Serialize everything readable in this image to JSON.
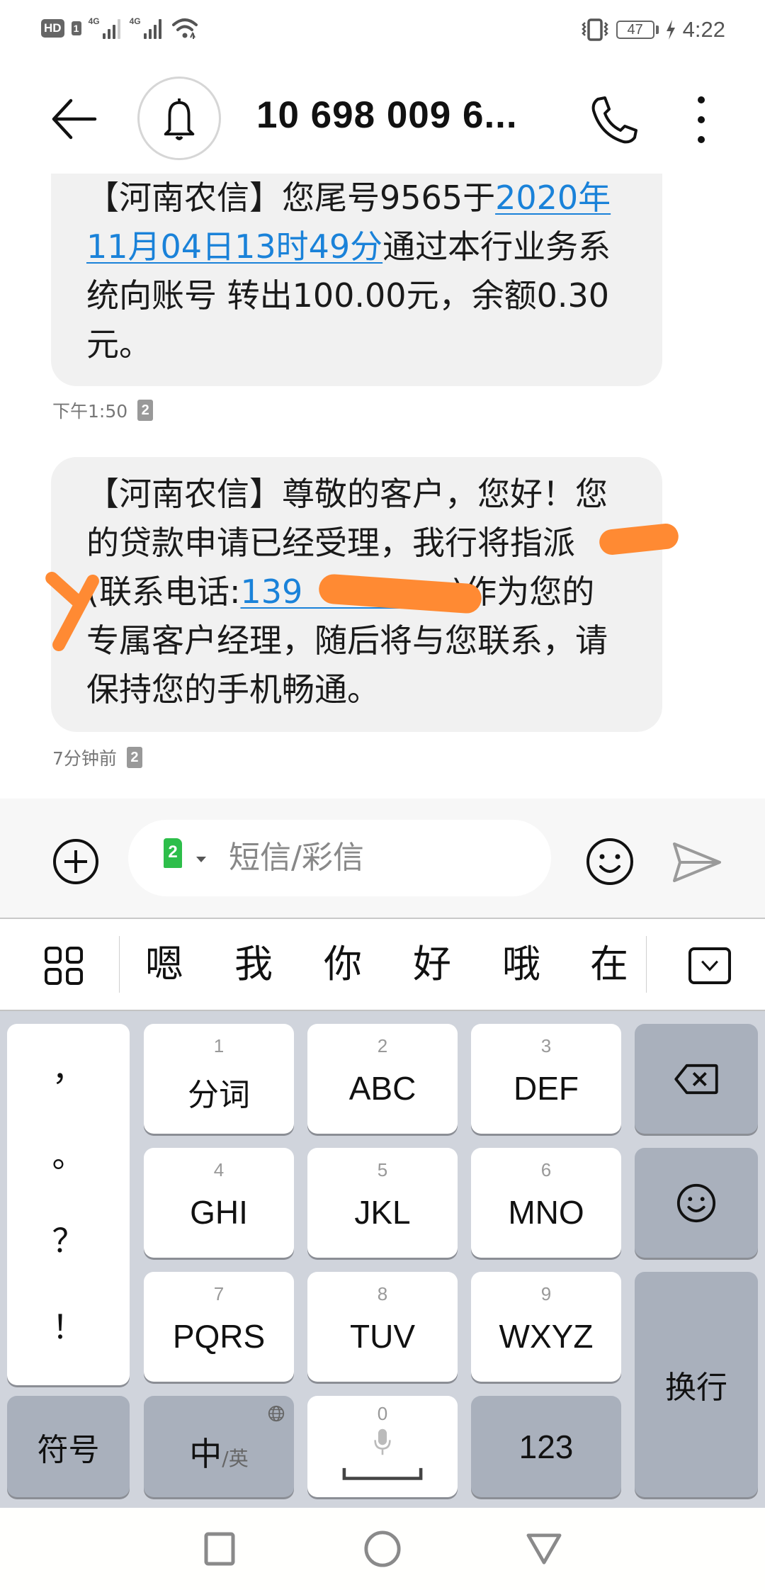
{
  "status_bar": {
    "hd_label": "HD",
    "sim_label": "1",
    "network_1": "4G",
    "network_2": "4G",
    "battery_level": "47",
    "time": "4:22",
    "icons": [
      "hd-voice-icon",
      "signal-icon",
      "signal-icon",
      "wifi-icon",
      "vibrate-icon",
      "battery-icon",
      "charging-icon"
    ]
  },
  "header": {
    "title": "10 698 009 6...",
    "icons": [
      "back-arrow-icon",
      "bell-icon",
      "phone-icon",
      "more-vertical-icon"
    ]
  },
  "messages": [
    {
      "segments": [
        {
          "text": "【河南农信】您尾号9565于",
          "link": false
        },
        {
          "text": "2020年11月04日13时49分",
          "link": true
        },
        {
          "text": "通过本行业务系统向账号 转出100.00元，余额0.30元。",
          "link": false
        }
      ],
      "timestamp": "下午1:50",
      "sim": "2"
    },
    {
      "segments": [
        {
          "text": "【河南农信】尊敬的客户，您好！您的贷款申请已经受理，我行将指派",
          "link": false
        },
        {
          "text": "[redacted]",
          "link": false,
          "redacted": true
        },
        {
          "text": "(联系电话:",
          "link": false
        },
        {
          "text": "139",
          "link": true,
          "partially_redacted": true
        },
        {
          "text": ")作为您的专属客户经理，随后将与您联系，请保持您的手机畅通。",
          "link": false
        }
      ],
      "timestamp": "7分钟前",
      "sim": "2"
    }
  ],
  "composer": {
    "sim_front": "2",
    "sim_back": "1",
    "placeholder": "短信/彩信",
    "value": "",
    "icons": [
      "add-icon",
      "sim-switch-icon",
      "emoji-icon",
      "send-icon"
    ]
  },
  "candidates": {
    "words": [
      "嗯",
      "我",
      "你",
      "好",
      "哦",
      "在"
    ],
    "icons": [
      "grid-menu-icon",
      "collapse-keyboard-icon"
    ]
  },
  "keyboard": {
    "punctuation": [
      "，",
      "。",
      "？",
      "！"
    ],
    "keys": [
      {
        "num": "1",
        "label": "分词"
      },
      {
        "num": "2",
        "label": "ABC"
      },
      {
        "num": "3",
        "label": "DEF"
      },
      {
        "num": "4",
        "label": "GHI"
      },
      {
        "num": "5",
        "label": "JKL"
      },
      {
        "num": "6",
        "label": "MNO"
      },
      {
        "num": "7",
        "label": "PQRS"
      },
      {
        "num": "8",
        "label": "TUV"
      },
      {
        "num": "9",
        "label": "WXYZ"
      }
    ],
    "symbols_label": "符号",
    "lang_main": "中",
    "lang_alt": "/英",
    "space_num": "0",
    "numbers_label": "123",
    "enter_label": "换行",
    "icons": [
      "backspace-icon",
      "emoji-icon",
      "globe-icon",
      "microphone-icon",
      "space-bar-icon"
    ]
  },
  "navbar": {
    "icons": [
      "recents-square-icon",
      "home-circle-icon",
      "back-triangle-icon"
    ]
  },
  "colors": {
    "link": "#1a82d9",
    "bubble_bg": "#f1f1f1",
    "keyboard_bg": "#d0d4dc",
    "dark_key": "#a9b0bc",
    "sim_green": "#2dbe4a",
    "redaction": "#ff8a33"
  }
}
